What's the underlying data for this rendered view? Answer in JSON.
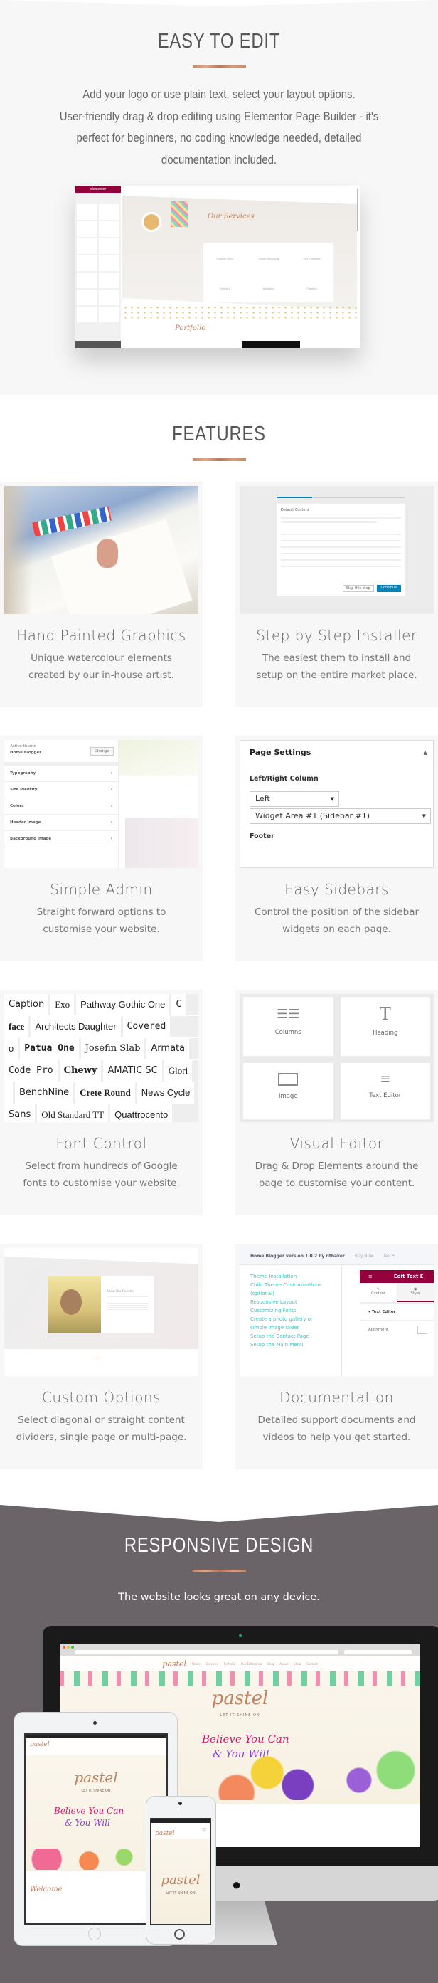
{
  "easy_to_edit": {
    "title": "EASY TO EDIT",
    "lines": [
      "Add your logo or use plain text, select your layout options.",
      "User-friendly drag & drop editing using Elementor Page Builder - it's",
      "perfect for beginners, no coding knowledge needed, detailed",
      "documentation included."
    ],
    "screenshot": {
      "panel_title": "elementor",
      "heading": "Our Services",
      "services": [
        "Custom Work",
        "Online Shopping",
        "Our Favorites",
        "Delivery",
        "Jewellery",
        "Painting"
      ],
      "portfolio": "Portfolio"
    }
  },
  "features": {
    "title": "FEATURES",
    "cards": [
      {
        "title": "Hand Painted Graphics",
        "desc": [
          "Unique watercolour elements",
          "created by our in-house artist."
        ]
      },
      {
        "title": "Step by Step Installer",
        "desc": [
          "The easiest them to install and",
          "setup on the entire market place."
        ],
        "dialog": {
          "heading": "Default Content",
          "skip": "Skip this step",
          "continue": "Continue"
        }
      },
      {
        "title": "Simple Admin",
        "desc": [
          "Straight forward options to",
          "customise your website."
        ],
        "admin": {
          "active_label": "Active theme",
          "theme": "Home Blogger",
          "change": "Change",
          "items": [
            "Typography",
            "Site Identity",
            "Colors",
            "Header Image",
            "Background Image"
          ]
        }
      },
      {
        "title": "Easy Sidebars",
        "desc": [
          "Control the position of the sidebar",
          "widgets on each page."
        ],
        "settings": {
          "heading": "Page Settings",
          "label": "Left/Right Column",
          "select1": "Left",
          "select2": "Widget Area #1 (Sidebar #1)",
          "footer": "Footer"
        }
      },
      {
        "title": "Font Control",
        "desc": [
          "Select from hundreds of Google",
          "fonts to customise your website."
        ],
        "fonts": [
          [
            "Caption",
            "Exo",
            "Pathway Gothic One",
            "C"
          ],
          [
            "face",
            "Architects Daughter",
            "Covered"
          ],
          [
            "o",
            "Patua One",
            "Josefin Slab",
            "Armata"
          ],
          [
            "Code Pro",
            "Chewy",
            "AMATIC SC",
            "Glori"
          ],
          [
            "",
            "BenchNine",
            "Crete Round",
            "News Cycle"
          ],
          [
            "Sans",
            "Old Standard TT",
            "Quattrocento"
          ]
        ]
      },
      {
        "title": "Visual Editor",
        "desc": [
          "Drag & Drop Elements around the",
          "page to customise your content."
        ],
        "widgets": [
          "Columns",
          "Heading",
          "Image",
          "Text Editor"
        ]
      },
      {
        "title": "Custom Options",
        "desc": [
          "Select diagonal or straight content",
          "dividers, single page or multi-page."
        ],
        "about": "About Our Founder"
      },
      {
        "title": "Documentation",
        "desc": [
          "Detailed support documents and",
          "videos to help you get started."
        ],
        "docs": {
          "header": "Home Blogger version 1.0.2 by dtbaker",
          "buy": "Buy Now",
          "get": "Get S",
          "links": [
            "Theme Installation",
            "Child Theme Customizations",
            "(optional)",
            "Responsive Layout",
            "Customizing Fonts",
            "Create a photo gallery or",
            "simple image slider",
            "Setup the Contact Page",
            "Setup the Main Menu"
          ],
          "panel_title": "Edit Text E",
          "tab_content": "Content",
          "tab_style": "Style",
          "section": "Text Editor",
          "alignment": "Alignment"
        }
      }
    ]
  },
  "responsive": {
    "title": "RESPONSIVE DESIGN",
    "subtitle": "The website looks great on any device.",
    "site": {
      "logo": "pastel",
      "tagline": "LET IT SHINE ON",
      "slogan1": "Believe You Can",
      "slogan2": "& You Will",
      "welcome": "Welcome",
      "nav": [
        "Home",
        "Services",
        "Portfolio",
        "Our Difference",
        "Blog",
        "About",
        "Shop",
        "Contact"
      ]
    }
  },
  "colors": {
    "accent": "#c98a66",
    "elementor": "#93003c",
    "dark_bg": "#6a6468",
    "link": "#3cc6c0",
    "button_blue": "#0085ba"
  }
}
